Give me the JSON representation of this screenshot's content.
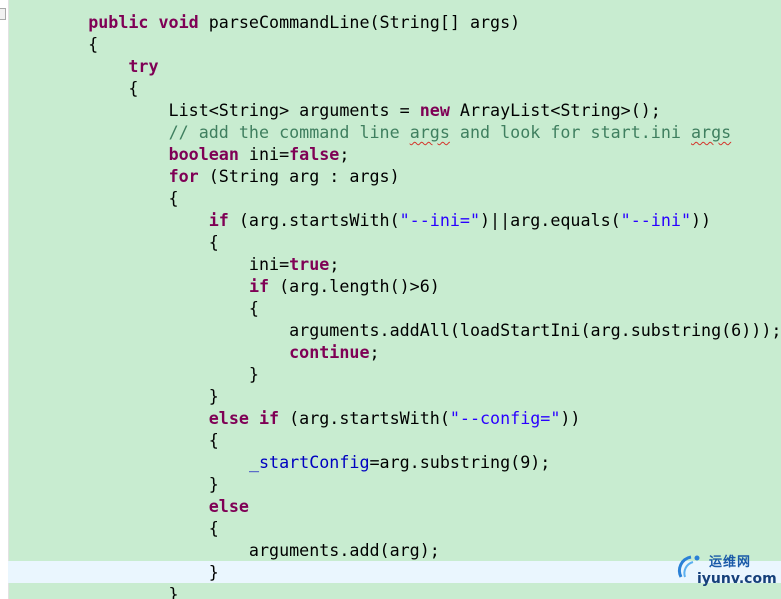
{
  "editor": {
    "colors": {
      "background": "#c8ecd0",
      "current_line": "#eaf6fe",
      "keyword": "#7f0055",
      "comment": "#3f7f5f",
      "string": "#2a00ff",
      "field": "#0000c0"
    },
    "lines": [
      [
        {
          "t": "    "
        },
        {
          "t": "public",
          "c": "kw"
        },
        {
          "t": " "
        },
        {
          "t": "void",
          "c": "kw"
        },
        {
          "t": " parseCommandLine(String[] args)"
        }
      ],
      [
        {
          "t": "    {"
        }
      ],
      [
        {
          "t": "        "
        },
        {
          "t": "try",
          "c": "kw"
        }
      ],
      [
        {
          "t": "        {"
        }
      ],
      [
        {
          "t": "            List<String> arguments = "
        },
        {
          "t": "new",
          "c": "kw"
        },
        {
          "t": " ArrayList<String>();"
        }
      ],
      [
        {
          "t": "            "
        },
        {
          "t": "// add the command line ",
          "c": "cm"
        },
        {
          "t": "args",
          "c": "cm spell"
        },
        {
          "t": " and look for start.ini ",
          "c": "cm"
        },
        {
          "t": "args",
          "c": "cm spell"
        }
      ],
      [
        {
          "t": "            "
        },
        {
          "t": "boolean",
          "c": "kw"
        },
        {
          "t": " ini="
        },
        {
          "t": "false",
          "c": "kw"
        },
        {
          "t": ";"
        }
      ],
      [
        {
          "t": "            "
        },
        {
          "t": "for",
          "c": "kw"
        },
        {
          "t": " (String arg : args)"
        }
      ],
      [
        {
          "t": "            {"
        }
      ],
      [
        {
          "t": "                "
        },
        {
          "t": "if",
          "c": "kw"
        },
        {
          "t": " (arg.startsWith("
        },
        {
          "t": "\"--ini=\"",
          "c": "str"
        },
        {
          "t": ")||arg.equals("
        },
        {
          "t": "\"--ini\"",
          "c": "str"
        },
        {
          "t": "))"
        }
      ],
      [
        {
          "t": "                {"
        }
      ],
      [
        {
          "t": "                    ini="
        },
        {
          "t": "true",
          "c": "kw"
        },
        {
          "t": ";"
        }
      ],
      [
        {
          "t": "                    "
        },
        {
          "t": "if",
          "c": "kw"
        },
        {
          "t": " (arg.length()>6)"
        }
      ],
      [
        {
          "t": "                    {"
        }
      ],
      [
        {
          "t": "                        arguments.addAll(loadStartIni(arg.substring(6)));"
        }
      ],
      [
        {
          "t": "                        "
        },
        {
          "t": "continue",
          "c": "kw"
        },
        {
          "t": ";"
        }
      ],
      [
        {
          "t": "                    }"
        }
      ],
      [
        {
          "t": "                }"
        }
      ],
      [
        {
          "t": "                "
        },
        {
          "t": "else",
          "c": "kw"
        },
        {
          "t": " "
        },
        {
          "t": "if",
          "c": "kw"
        },
        {
          "t": " (arg.startsWith("
        },
        {
          "t": "\"--config=\"",
          "c": "str"
        },
        {
          "t": "))"
        }
      ],
      [
        {
          "t": "                {"
        }
      ],
      [
        {
          "t": "                    "
        },
        {
          "t": "_startConfig",
          "c": "fld"
        },
        {
          "t": "=arg.substring(9);"
        }
      ],
      [
        {
          "t": "                }"
        }
      ],
      [
        {
          "t": "                "
        },
        {
          "t": "else",
          "c": "kw"
        }
      ],
      [
        {
          "t": "                {"
        }
      ],
      [
        {
          "t": "                    arguments.add(arg);"
        }
      ],
      [
        {
          "t": "                }"
        }
      ],
      [
        {
          "t": "            }"
        }
      ]
    ],
    "current_line_index": 25
  },
  "watermark": {
    "brand": "运维网",
    "domain": "iyunv.com"
  }
}
